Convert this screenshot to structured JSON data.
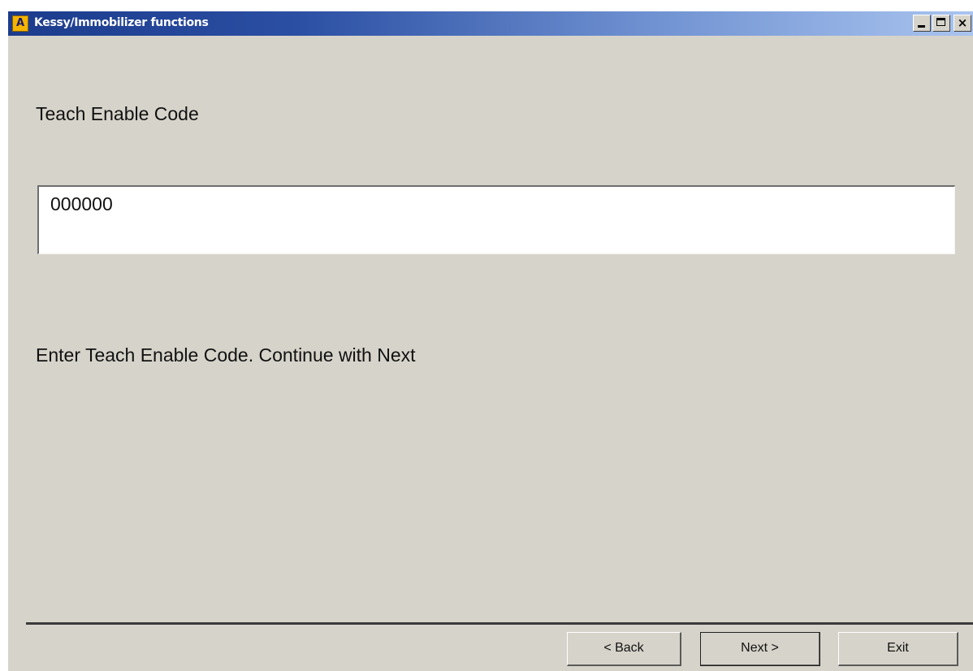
{
  "window": {
    "title": "Kessy/Immobilizer functions",
    "icon_letter": "A",
    "controls": [
      "minimize-icon",
      "maximize-icon",
      "close-icon"
    ]
  },
  "main": {
    "heading": "Teach Enable Code",
    "code_input": {
      "value": "000000"
    },
    "hint": "Enter Teach Enable Code. Continue with Next"
  },
  "footer": {
    "back_label": "< Back",
    "next_label": "Next >",
    "exit_label": "Exit"
  },
  "colors": {
    "dialog_background": "#d6d3ca",
    "titlebar_start": "#1c3b8c",
    "titlebar_end": "#a9c4ef",
    "app_icon": "#f4b400"
  }
}
